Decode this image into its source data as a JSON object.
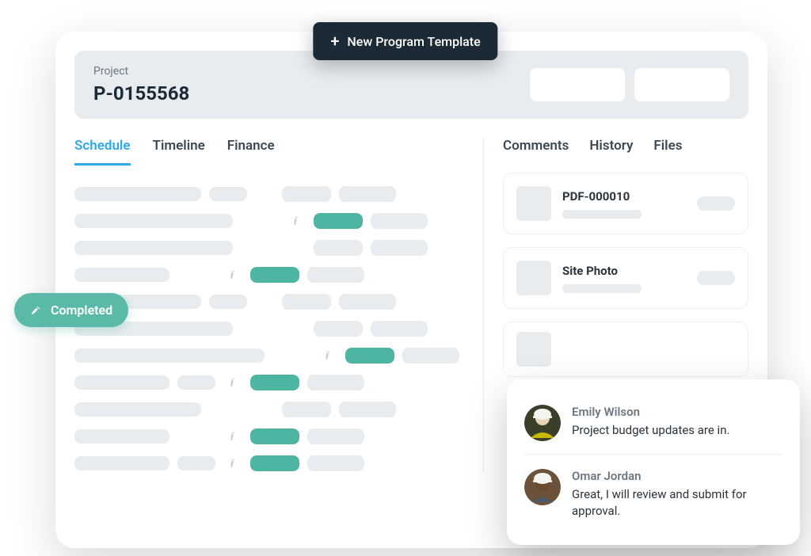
{
  "header_button": "New Program Template",
  "project": {
    "label": "Project",
    "id": "P-0155568"
  },
  "left_tabs": [
    "Schedule",
    "Timeline",
    "Finance"
  ],
  "left_tab_active": "Schedule",
  "right_tabs": [
    "Comments",
    "History",
    "Files"
  ],
  "completed_badge": "Completed",
  "files": [
    {
      "title": "PDF-000010"
    },
    {
      "title": "Site Photo"
    }
  ],
  "comments": [
    {
      "author": "Emily Wilson",
      "text": "Project budget updates are in."
    },
    {
      "author": "Omar Jordan",
      "text": "Great, I will review and submit for approval."
    }
  ],
  "schedule_rows": [
    {
      "w": "col1s",
      "showCol2": true,
      "pin": false,
      "status": "grey"
    },
    {
      "w": "col1",
      "showCol2": false,
      "pin": true,
      "status": "teal"
    },
    {
      "w": "col1",
      "showCol2": false,
      "pin": false,
      "status": "grey"
    },
    {
      "w": "col1xs",
      "showCol2": false,
      "pin": true,
      "status": "teal"
    },
    {
      "w": "col1s",
      "showCol2": true,
      "pin": false,
      "status": "grey"
    },
    {
      "w": "col1",
      "showCol2": false,
      "pin": false,
      "status": "grey"
    },
    {
      "w": "col1l",
      "showCol2": false,
      "pin": true,
      "status": "teal"
    },
    {
      "w": "col1xs",
      "showCol2": true,
      "pin": true,
      "status": "teal"
    },
    {
      "w": "col1s",
      "showCol2": false,
      "pin": false,
      "status": "grey"
    },
    {
      "w": "col1xs",
      "showCol2": false,
      "pin": true,
      "status": "teal"
    },
    {
      "w": "col1xs",
      "showCol2": true,
      "pin": true,
      "status": "teal"
    }
  ]
}
